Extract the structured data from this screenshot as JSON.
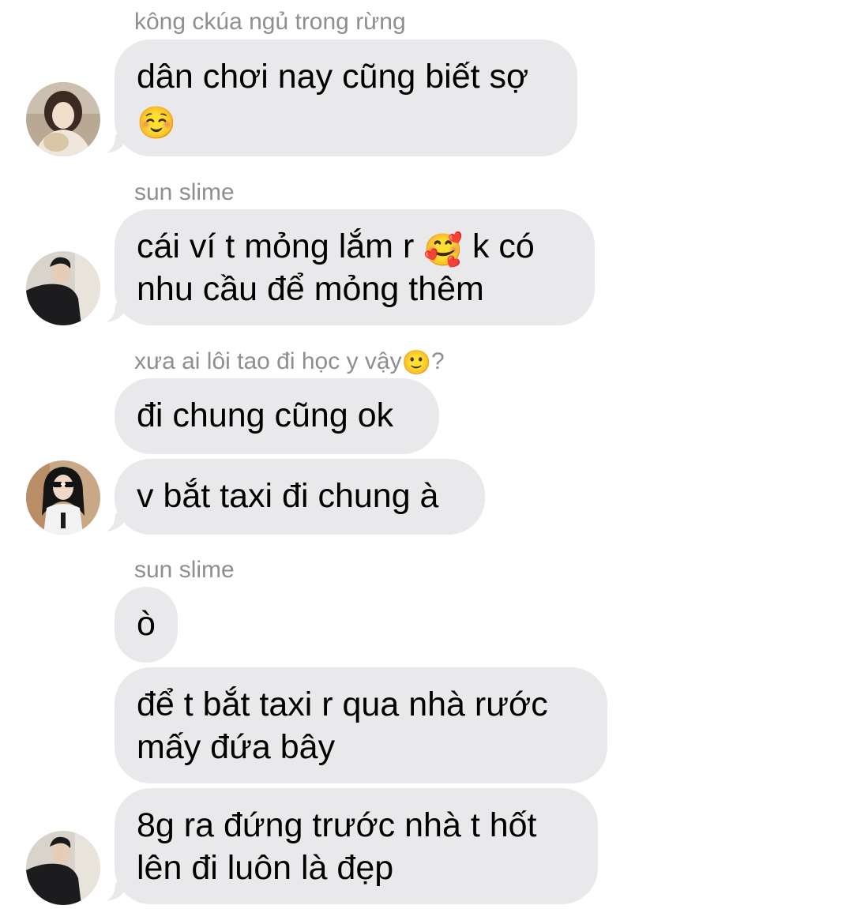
{
  "messages": [
    {
      "sender": "kông ckúa ngủ trong rừng",
      "lines": [
        "dân chơi nay cũng biết sợ",
        ""
      ],
      "emoji": "☺️"
    },
    {
      "sender": "sun slime",
      "line1_a": "cái ví t mỏng lắm r ",
      "line1_emoji": "🥰",
      "line1_b": " k có",
      "line2": "nhu cầu để mỏng thêm"
    },
    {
      "sender_a": "xưa ai lôi tao đi học y vậy",
      "sender_emoji": "🙂",
      "sender_b": "?",
      "bubble1": "đi chung cũng ok",
      "bubble2": "v bắt taxi đi chung à"
    },
    {
      "sender": "sun slime",
      "bubble1": "ò",
      "bubble2_line1": "để t bắt taxi r qua nhà rước",
      "bubble2_line2": "mấy đứa bây",
      "bubble3_line1": "8g ra đứng trước nhà t hốt",
      "bubble3_line2": "lên đi luôn là đẹp"
    }
  ],
  "colors": {
    "bubble": "#e9e9eb",
    "sender_text": "#8e8e93",
    "background": "#ffffff"
  },
  "avatars": [
    "avatar-girl-with-plush",
    "avatar-guy-dark-jacket",
    "avatar-girl-sunglasses",
    "avatar-guy-dark-jacket"
  ]
}
